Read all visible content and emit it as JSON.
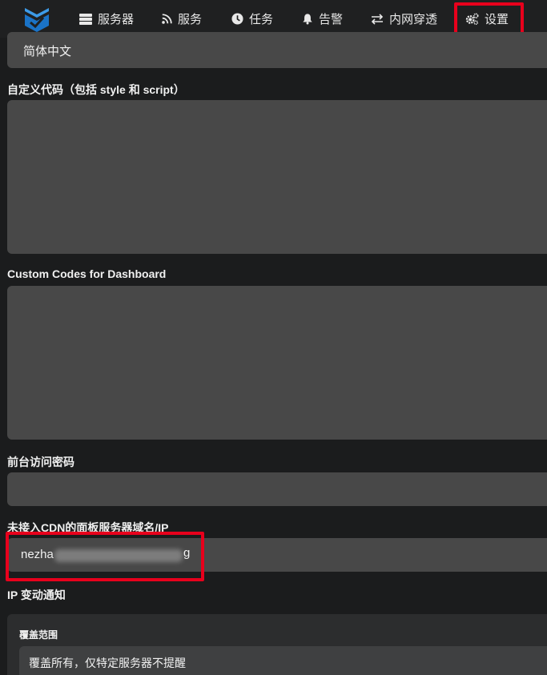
{
  "nav": {
    "items": [
      {
        "label": "服务器",
        "icon": "server-icon"
      },
      {
        "label": "服务",
        "icon": "rss-icon"
      },
      {
        "label": "任务",
        "icon": "clock-icon"
      },
      {
        "label": "告警",
        "icon": "bell-icon"
      },
      {
        "label": "内网穿透",
        "icon": "exchange-icon"
      },
      {
        "label": "设置",
        "icon": "cogs-icon"
      }
    ]
  },
  "form": {
    "language_value": "简体中文",
    "custom_code_label": "自定义代码（包括 style 和 script）",
    "dashboard_code_label": "Custom Codes for Dashboard",
    "frontend_password_label": "前台访问密码",
    "domain_label": "未接入CDN的面板服务器域名/IP",
    "domain_value_prefix": "nezha",
    "domain_value_suffix": "g",
    "ip_notify_label": "IP 变动通知",
    "coverage_label": "覆盖范围",
    "coverage_value": "覆盖所有，仅特定服务器不提醒"
  },
  "colors": {
    "highlight": "#e8001c",
    "logo_dark": "#1a73c7",
    "logo_light": "#3d9be8"
  }
}
